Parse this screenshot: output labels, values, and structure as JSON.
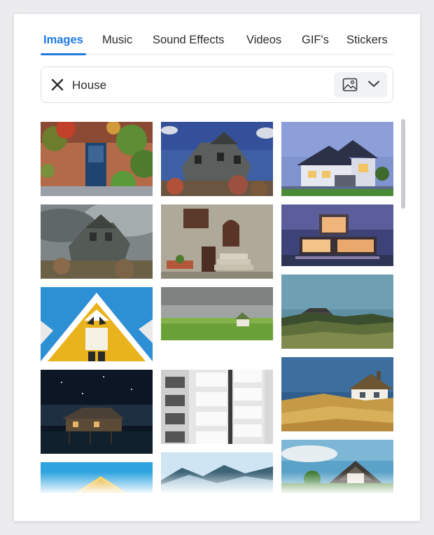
{
  "tabs": [
    {
      "label": "Images",
      "active": true
    },
    {
      "label": "Music",
      "active": false
    },
    {
      "label": "Sound Effects",
      "active": false
    },
    {
      "label": "Videos",
      "active": false
    },
    {
      "label": "GIF's",
      "active": false
    },
    {
      "label": "Stickers",
      "active": false
    }
  ],
  "search": {
    "value": "House",
    "clear_icon": "close-icon",
    "type_filter_icon": "image-icon",
    "dropdown_icon": "chevron-down-icon"
  },
  "results": {
    "column_1": [
      {
        "subject": "ivy-covered doorway"
      },
      {
        "subject": "old wooden house under storm sky"
      },
      {
        "subject": "yellow triangular roof house"
      },
      {
        "subject": "stilt house at night"
      },
      {
        "subject": "yellow roof under blue sky"
      }
    ],
    "column_2": [
      {
        "subject": "gray victorian house on hill"
      },
      {
        "subject": "stone wall with arched door"
      },
      {
        "subject": "small house on green meadow"
      },
      {
        "subject": "white apartment balconies"
      },
      {
        "subject": "snowy mountain ridge"
      }
    ],
    "column_3": [
      {
        "subject": "modern suburban house at dusk"
      },
      {
        "subject": "glass cube house at twilight"
      },
      {
        "subject": "house behind grassy dunes"
      },
      {
        "subject": "thatched cottage on dunes"
      },
      {
        "subject": "farmhouse roof against sky"
      }
    ]
  },
  "colors": {
    "accent": "#1f7ae0",
    "text": "#2b2b2f",
    "border": "#dcdfe4"
  }
}
